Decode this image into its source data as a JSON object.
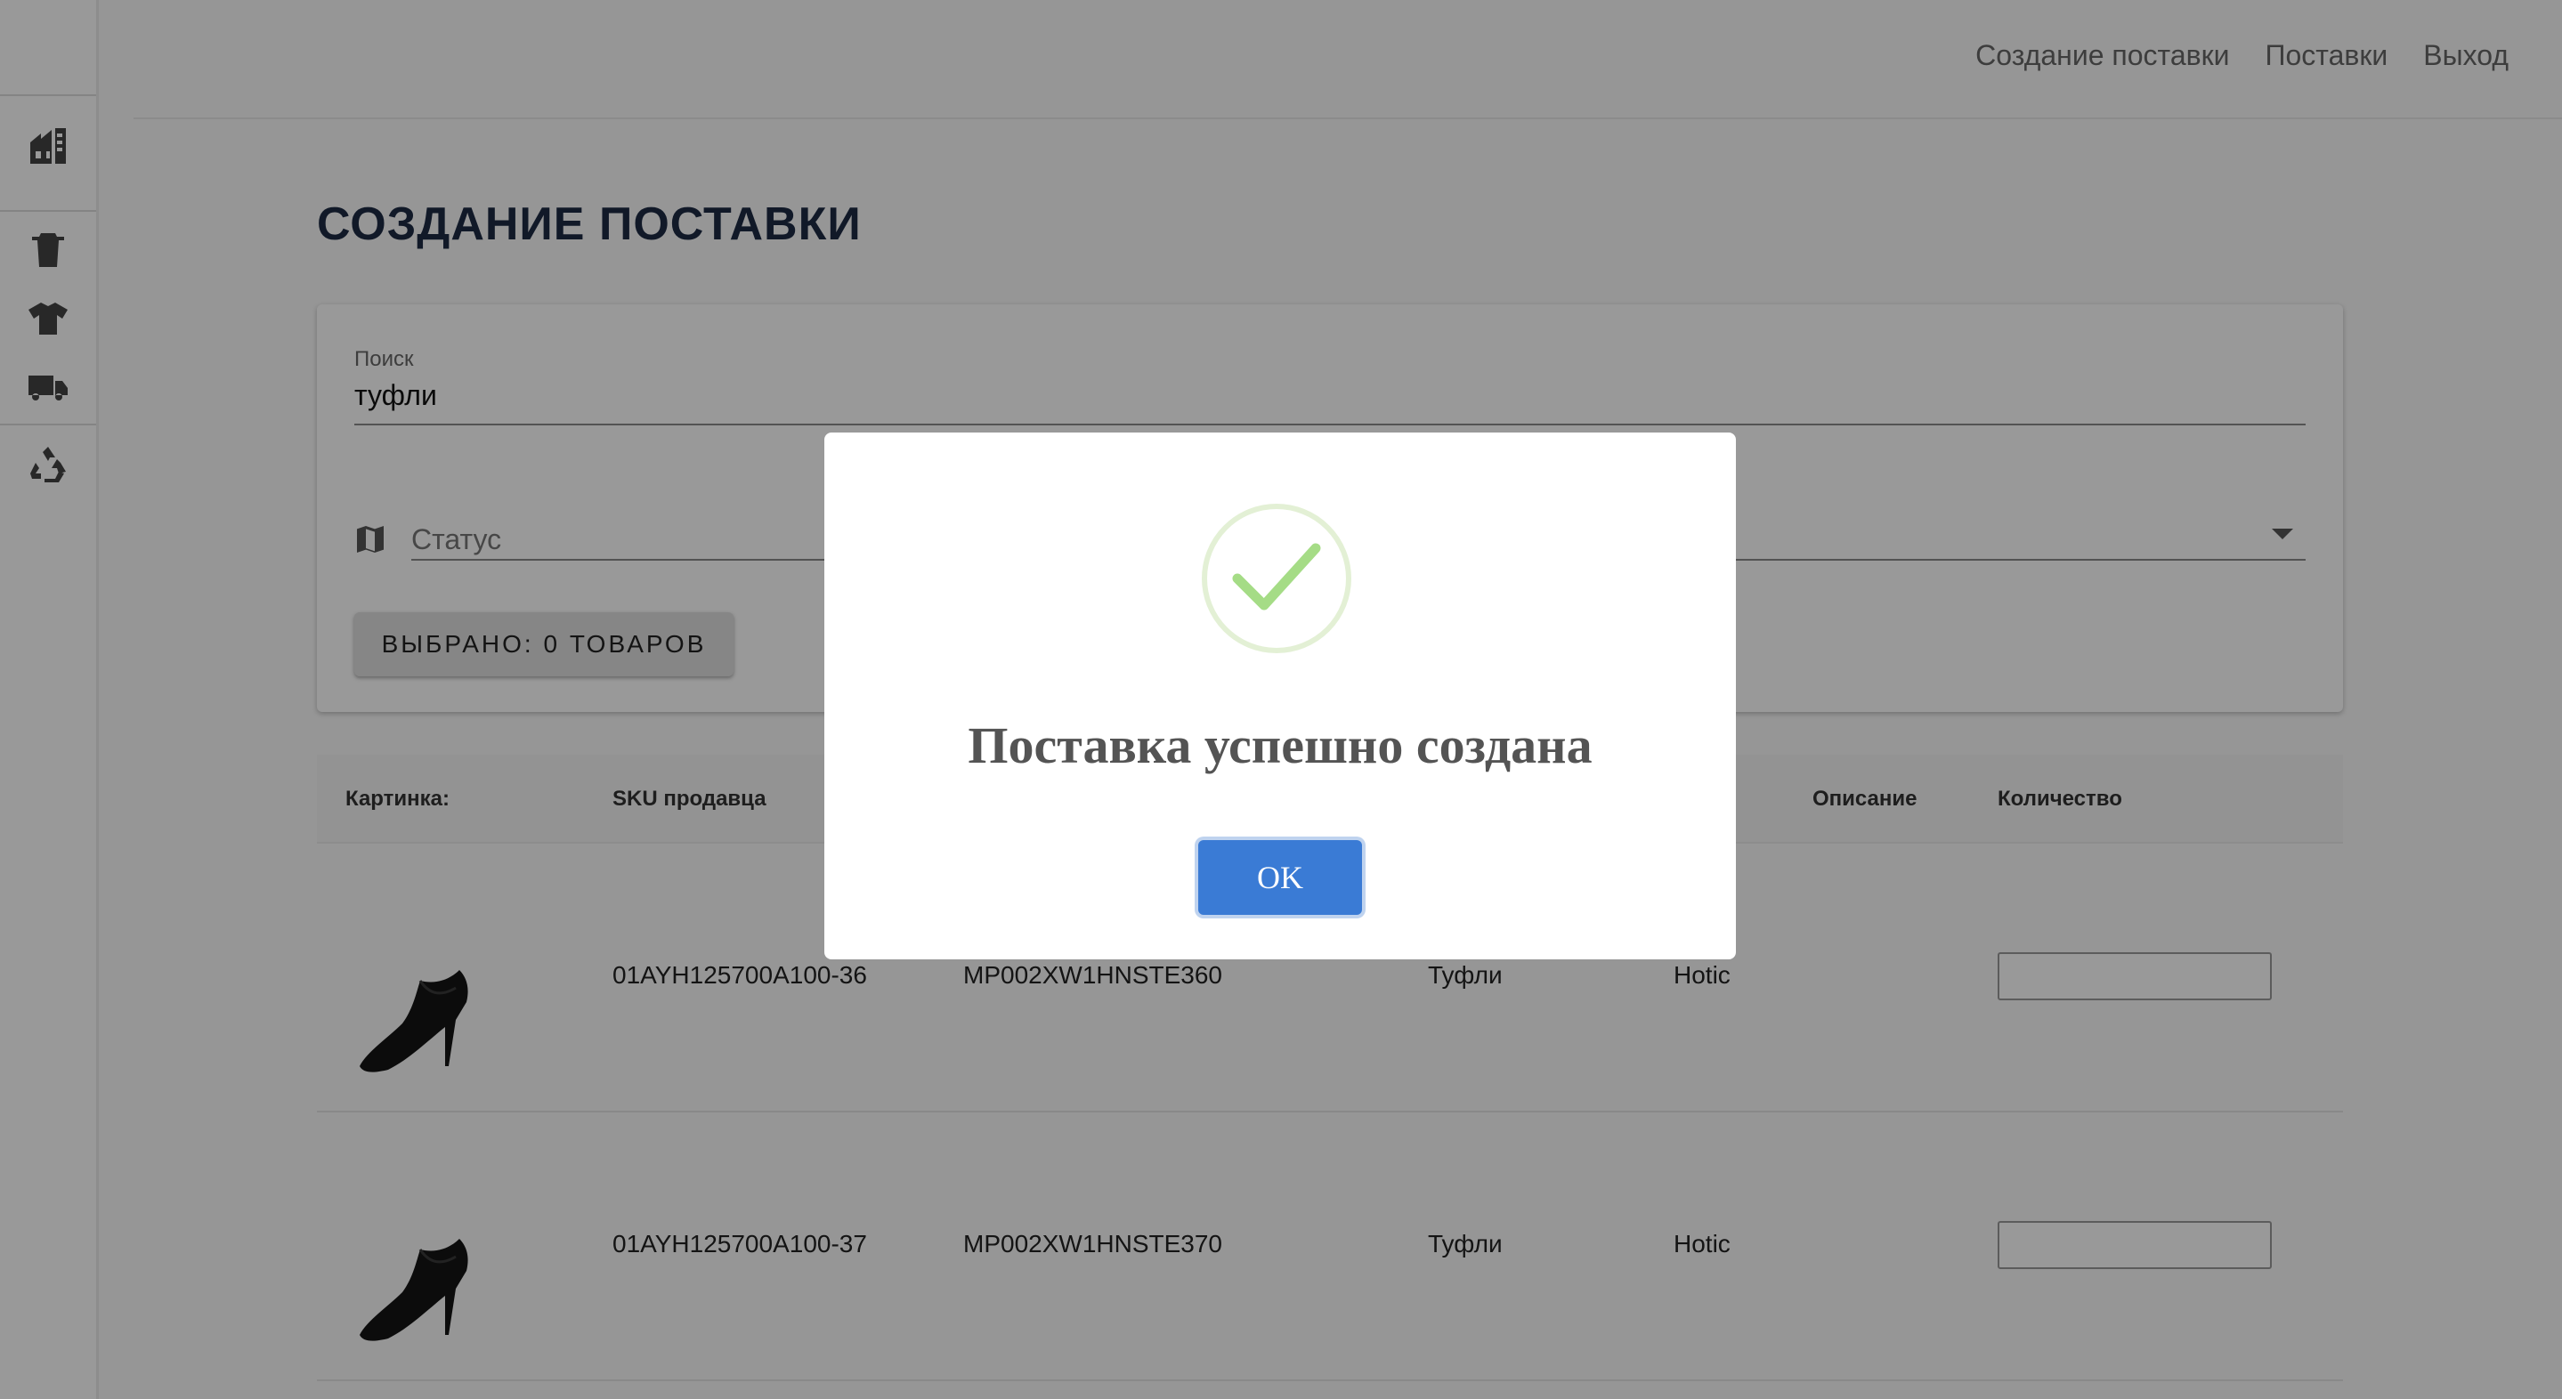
{
  "nav": {
    "links": [
      "Создание поставки",
      "Поставки",
      "Выход"
    ]
  },
  "sidebar": {
    "icons": [
      "warehouse-icon",
      "trash-icon",
      "tshirt-icon",
      "truck-icon",
      "recycle-icon"
    ]
  },
  "page": {
    "title": "СОЗДАНИЕ ПОСТАВКИ"
  },
  "filters": {
    "search_label": "Поиск",
    "search_value": "туфли",
    "status_placeholder": "Статус",
    "selected_button": "ВЫБРАНО: 0 ТОВАРОВ"
  },
  "table": {
    "headers": {
      "image": "Картинка:",
      "seller_sku": "SKU продавца",
      "description": "Описание",
      "quantity": "Количество"
    },
    "rows": [
      {
        "seller_sku": "01AYH125700A100-36",
        "sku": "MP002XW1HNSTE360",
        "type": "Туфли",
        "brand": "Hotic",
        "quantity": ""
      },
      {
        "seller_sku": "01AYH125700A100-37",
        "sku": "MP002XW1HNSTE370",
        "type": "Туфли",
        "brand": "Hotic",
        "quantity": ""
      }
    ]
  },
  "modal": {
    "icon": "checkmark-icon",
    "title": "Поставка успешно создана",
    "ok_label": "OK"
  },
  "colors": {
    "accent": "#3a7bd5",
    "success": "#a5dc86",
    "title": "#1d2a44"
  }
}
